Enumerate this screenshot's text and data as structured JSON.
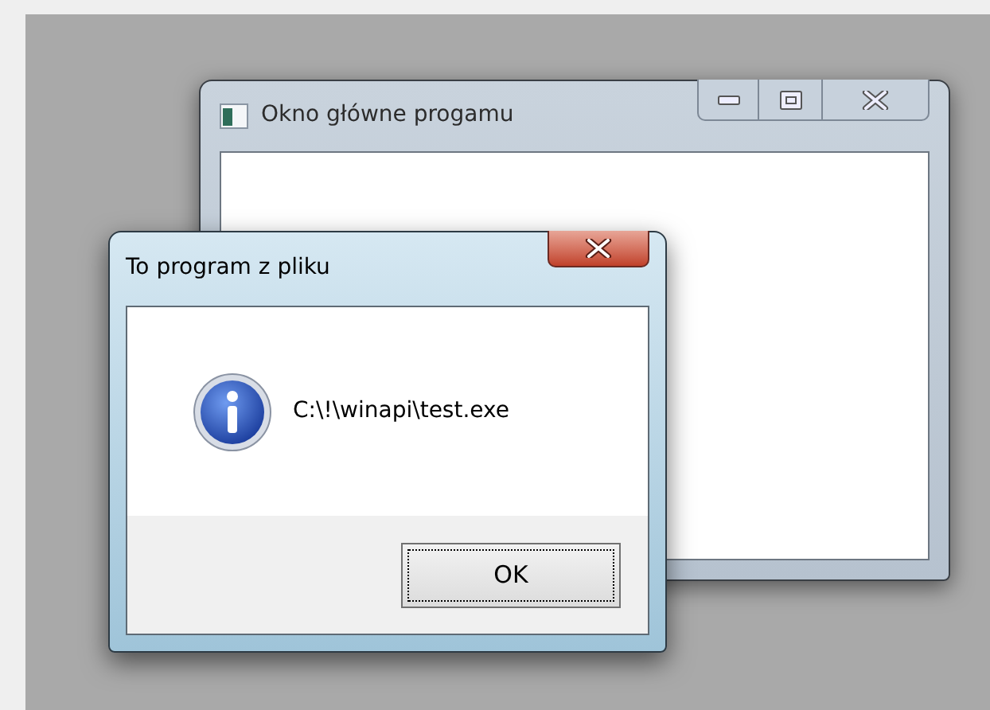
{
  "main_window": {
    "title": "Okno główne progamu"
  },
  "dialog": {
    "title": "To program z pliku",
    "message": "C:\\!\\winapi\\test.exe",
    "buttons": [
      {
        "label": "OK",
        "focused": true
      }
    ]
  }
}
